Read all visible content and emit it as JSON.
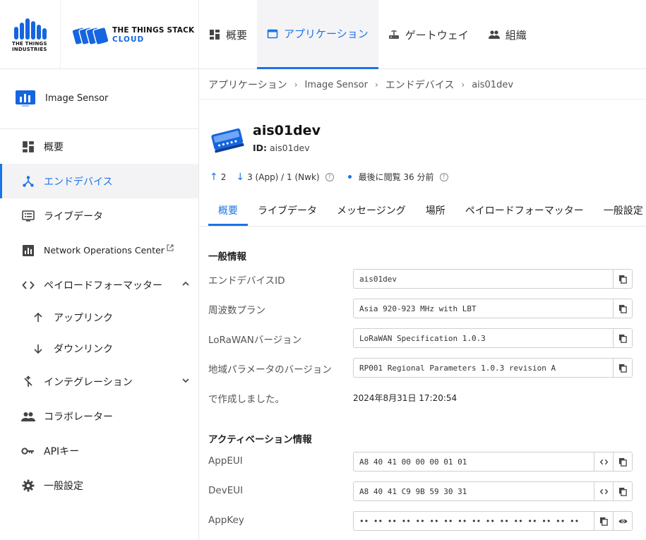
{
  "brand": {
    "company_line1": "THE THINGS",
    "company_line2": "INDUSTRIES",
    "product_name": "THE THINGS STACK",
    "product_tier": "CLOUD",
    "accent_color": "#1a73e8"
  },
  "topnav": [
    {
      "label": "概要",
      "icon": "dashboard-icon"
    },
    {
      "label": "アプリケーション",
      "icon": "application-icon",
      "active": true
    },
    {
      "label": "ゲートウェイ",
      "icon": "router-icon"
    },
    {
      "label": "組織",
      "icon": "people-icon"
    }
  ],
  "sidebar": {
    "app_name": "Image Sensor",
    "items": [
      {
        "label": "概要",
        "icon": "dashboard-icon"
      },
      {
        "label": "エンドデバイス",
        "icon": "device-hub-icon",
        "active": true
      },
      {
        "label": "ライブデータ",
        "icon": "list-alt-icon"
      },
      {
        "label": "Network Operations Center",
        "icon": "bar-chart-icon"
      },
      {
        "label": "ペイロードフォーマッター",
        "icon": "code-icon"
      },
      {
        "label": "アップリンク",
        "icon": "arrow-up-icon"
      },
      {
        "label": "ダウンリンク",
        "icon": "arrow-down-icon"
      },
      {
        "label": "インテグレーション",
        "icon": "merge-icon"
      },
      {
        "label": "コラボレーター",
        "icon": "group-icon"
      },
      {
        "label": "APIキー",
        "icon": "key-icon"
      },
      {
        "label": "一般設定",
        "icon": "gear-icon"
      }
    ]
  },
  "breadcrumb": [
    "アプリケーション",
    "Image Sensor",
    "エンドデバイス",
    "ais01dev"
  ],
  "device": {
    "title": "ais01dev",
    "id_label": "ID:",
    "id_value": "ais01dev"
  },
  "stats": {
    "uplink": "2",
    "downlink": "3 (App) / 1 (Nwk)",
    "last_seen": "最後に閲覧 36 分前"
  },
  "tabs": [
    "概要",
    "ライブデータ",
    "メッセージング",
    "場所",
    "ペイロードフォーマッター",
    "一般設定"
  ],
  "general": {
    "title": "一般情報",
    "fields": [
      {
        "label": "エンドデバイスID",
        "value": "ais01dev"
      },
      {
        "label": "周波数プラン",
        "value": "Asia 920-923 MHz with LBT"
      },
      {
        "label": "LoRaWANバージョン",
        "value": "LoRaWAN Specification 1.0.3"
      },
      {
        "label": "地域パラメータのバージョン",
        "value": "RP001 Regional Parameters 1.0.3 revision A"
      }
    ],
    "created_label": "で作成しました。",
    "created_value": "2024年8月31日 17:20:54"
  },
  "activation": {
    "title": "アクティベーション情報",
    "fields": [
      {
        "label": "AppEUI",
        "value": "A8 40 41 00 00 00 01 01"
      },
      {
        "label": "DevEUI",
        "value": "A8 40 41 C9 9B 59 30 31"
      },
      {
        "label": "AppKey",
        "value": "•• •• •• •• •• •• •• •• •• •• •• •• •• •• •• ••"
      }
    ]
  }
}
